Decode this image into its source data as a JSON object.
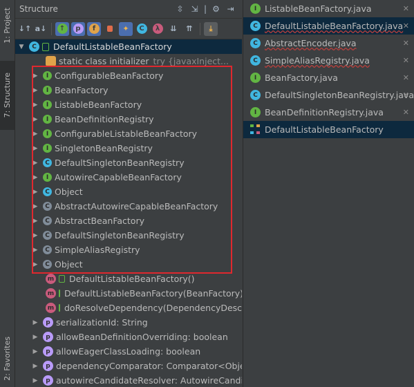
{
  "tool_strip": {
    "project_tab": "1: Project",
    "structure_tab": "7: Structure",
    "favorites_tab": "2: Favorites"
  },
  "structure": {
    "title": "Structure",
    "toolbar_icons": [
      "sort-by-visibility-icon",
      "sort-alpha-icon",
      "show-inherited-icon",
      "show-properties-icon",
      "show-fields-icon",
      "show-non-public-icon",
      "autoscroll-to-source-icon",
      "show-anonymous-icon",
      "show-lambdas-icon",
      "expand-all-icon",
      "collapse-all-icon",
      "autoscroll-from-source-icon"
    ],
    "toolbar_letters": {
      "p": "p",
      "f": "f",
      "lambda": "λ"
    },
    "root": "DefaultListableBeanFactory",
    "static_init": {
      "label": "static class initializer",
      "detail": "try {javaxInject..."
    },
    "supertypes": [
      {
        "label": "ConfigurableBeanFactory",
        "kind": "interface"
      },
      {
        "label": "BeanFactory",
        "kind": "interface"
      },
      {
        "label": "ListableBeanFactory",
        "kind": "interface"
      },
      {
        "label": "BeanDefinitionRegistry",
        "kind": "interface"
      },
      {
        "label": "ConfigurableListableBeanFactory",
        "kind": "interface"
      },
      {
        "label": "SingletonBeanRegistry",
        "kind": "interface"
      },
      {
        "label": "DefaultSingletonBeanRegistry",
        "kind": "class"
      },
      {
        "label": "AutowireCapableBeanFactory",
        "kind": "interface"
      },
      {
        "label": "Object",
        "kind": "class"
      },
      {
        "label": "AbstractAutowireCapableBeanFactory",
        "kind": "abstract"
      },
      {
        "label": "AbstractBeanFactory",
        "kind": "abstract"
      },
      {
        "label": "DefaultSingletonBeanRegistry",
        "kind": "abstract"
      },
      {
        "label": "SimpleAliasRegistry",
        "kind": "abstract"
      },
      {
        "label": "Object",
        "kind": "abstract"
      }
    ],
    "methods": [
      "DefaultListableBeanFactory()",
      "DefaultListableBeanFactory(BeanFactory)",
      "doResolveDependency(DependencyDescrip"
    ],
    "fields": [
      "serializationId: String",
      "allowBeanDefinitionOverriding: boolean",
      "allowEagerClassLoading: boolean",
      "dependencyComparator: Comparator<Object",
      "autowireCandidateResolver: AutowireCandidat"
    ]
  },
  "recent_files": [
    {
      "name": "ListableBeanFactory.java",
      "kind": "interface",
      "error": false
    },
    {
      "name": "DefaultListableBeanFactory.java",
      "kind": "class",
      "error": true
    },
    {
      "name": "AbstractEncoder.java",
      "kind": "class",
      "error": true
    },
    {
      "name": "SimpleAliasRegistry.java",
      "kind": "class",
      "error": true
    },
    {
      "name": "BeanFactory.java",
      "kind": "interface",
      "error": false
    },
    {
      "name": "DefaultSingletonBeanRegistry.java",
      "kind": "class",
      "error": false
    },
    {
      "name": "BeanDefinitionRegistry.java",
      "kind": "interface",
      "error": false
    },
    {
      "name": "DefaultListableBeanFactory",
      "kind": "diagram",
      "error": false
    }
  ],
  "colors": {
    "selection": "#0d293e",
    "highlight_box": "#e0282e",
    "interface_icon": "#62b543",
    "class_icon": "#40b6e0",
    "method_icon": "#c95b7c",
    "field_icon": "#b99bf8"
  }
}
